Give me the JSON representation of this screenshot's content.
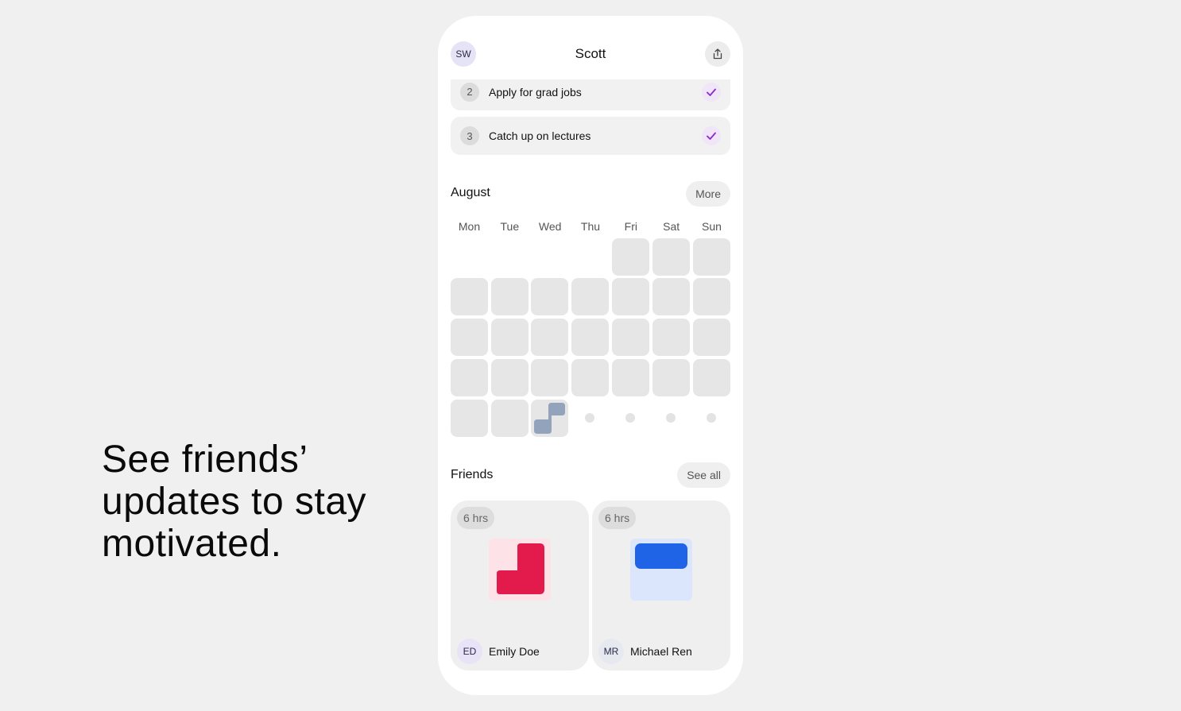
{
  "headline": [
    "See friends’",
    "updates to stay",
    "motivated."
  ],
  "header": {
    "avatar_initials": "SW",
    "title": "Scott",
    "share_icon": "share-icon"
  },
  "tasks": [
    {
      "number": "2",
      "label": "Apply for grad jobs",
      "done": true
    },
    {
      "number": "3",
      "label": "Catch up on lectures",
      "done": true
    }
  ],
  "calendar": {
    "month": "August",
    "more_label": "More",
    "weekdays": [
      "Mon",
      "Tue",
      "Wed",
      "Thu",
      "Fri",
      "Sat",
      "Sun"
    ]
  },
  "friends": {
    "title": "Friends",
    "see_all_label": "See all",
    "cards": [
      {
        "hours": "6 hrs",
        "initials": "ED",
        "name": "Emily Doe",
        "accent": "#e31b4c",
        "accent_bg": "#fde3e7"
      },
      {
        "hours": "6 hrs",
        "initials": "MR",
        "name": "Michael Ren",
        "accent": "#1f63e6",
        "accent_bg": "#dbe6fd"
      }
    ]
  },
  "colors": {
    "background": "#f0f0f0",
    "check": "#8a2bd0",
    "today_shape": "#93a3bb"
  }
}
